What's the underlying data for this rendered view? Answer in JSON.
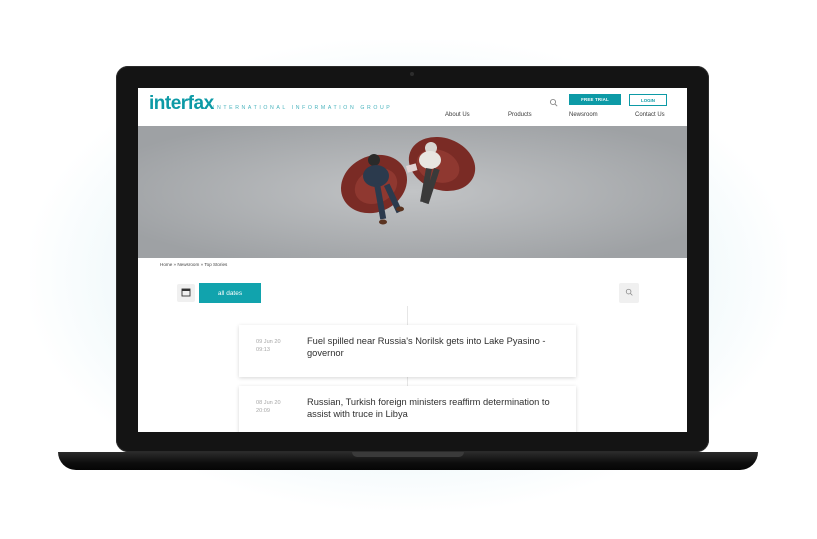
{
  "site": {
    "logo_text": "interfax",
    "tagline": "INTERNATIONAL INFORMATION GROUP",
    "brand_color": "#0d9aa6",
    "free_trial_label": "FREE TRIAL",
    "login_label": "LOGIN",
    "nav": [
      "About Us",
      "Products",
      "Newsroom",
      "Contact Us"
    ]
  },
  "breadcrumb": "Home » Newsroom » Top Stories",
  "filters": {
    "dates_label": "all dates"
  },
  "news": [
    {
      "date": "09 Jun 20",
      "time": "09:13",
      "title": "Fuel spilled near Russia's Norilsk gets into Lake Pyasino - governor"
    },
    {
      "date": "08 Jun 20",
      "time": "20:09",
      "title": "Russian, Turkish foreign ministers reaffirm determination to assist with truce in Libya"
    }
  ],
  "icons": {
    "search": "search-icon",
    "calendar": "calendar-icon"
  }
}
